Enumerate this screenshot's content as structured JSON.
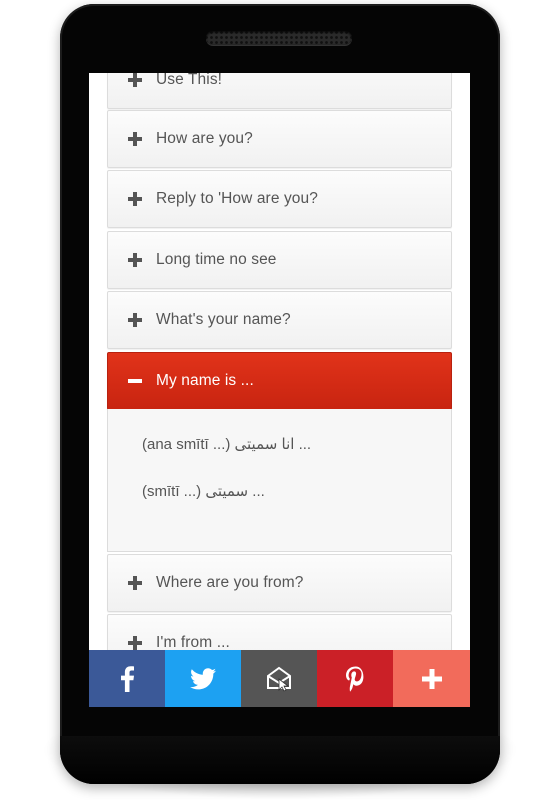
{
  "accordion": {
    "items": [
      {
        "label": "Use This!",
        "state": "collapsed"
      },
      {
        "label": "How are you?",
        "state": "collapsed"
      },
      {
        "label": "Reply to 'How are you?",
        "state": "collapsed"
      },
      {
        "label": "Long time no see",
        "state": "collapsed"
      },
      {
        "label": "What's your name?",
        "state": "collapsed"
      },
      {
        "label": "My name is ...",
        "state": "expanded"
      },
      {
        "label": "Where are you from?",
        "state": "collapsed"
      },
      {
        "label": "I'm from ...",
        "state": "collapsed"
      }
    ],
    "expanded_content": [
      "(ana smītī ...) انا سميتى ...",
      "(smītī ...) سميتى ..."
    ]
  },
  "share_bar": {
    "buttons": [
      {
        "name": "facebook",
        "icon": "facebook-icon",
        "glyph": "f",
        "color": "#3b5998"
      },
      {
        "name": "twitter",
        "icon": "twitter-icon",
        "glyph": "🐦",
        "color": "#1da1f2"
      },
      {
        "name": "email",
        "icon": "email-icon",
        "glyph": "✉",
        "color": "#555555"
      },
      {
        "name": "pinterest",
        "icon": "pinterest-icon",
        "glyph": "p",
        "color": "#cb2027"
      },
      {
        "name": "more",
        "icon": "plus-icon",
        "glyph": "+",
        "color": "#f26b5b"
      }
    ]
  },
  "colors": {
    "active_item": "#d52c16",
    "text": "#555555"
  }
}
